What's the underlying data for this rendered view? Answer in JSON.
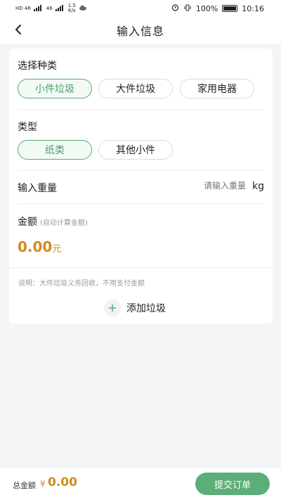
{
  "status_bar": {
    "network_1": "HD 46",
    "network_2": "46",
    "speed_value": "1.5",
    "speed_unit": "K/s",
    "battery_percent": "100%",
    "time": "10:16"
  },
  "nav": {
    "title": "输入信息"
  },
  "category": {
    "label": "选择种类",
    "options": [
      "小件垃圾",
      "大件垃圾",
      "家用电器"
    ],
    "selected_index": 0
  },
  "type": {
    "label": "类型",
    "options": [
      "纸类",
      "其他小件"
    ],
    "selected_index": 0
  },
  "weight": {
    "label": "输入重量",
    "placeholder": "请输入重量",
    "unit": "kg"
  },
  "amount": {
    "label": "金额",
    "hint": "(自动计算金额)",
    "value": "0.00",
    "unit": "元"
  },
  "note": "说明：大件垃圾义务回收，不用支付金额",
  "add_button_label": "添加垃圾",
  "footer": {
    "total_label": "总金额",
    "currency_symbol": "¥",
    "total_value": "0.00",
    "submit_label": "提交订单"
  },
  "colors": {
    "accent_green": "#5cae78",
    "amount_orange": "#d48a1e"
  }
}
